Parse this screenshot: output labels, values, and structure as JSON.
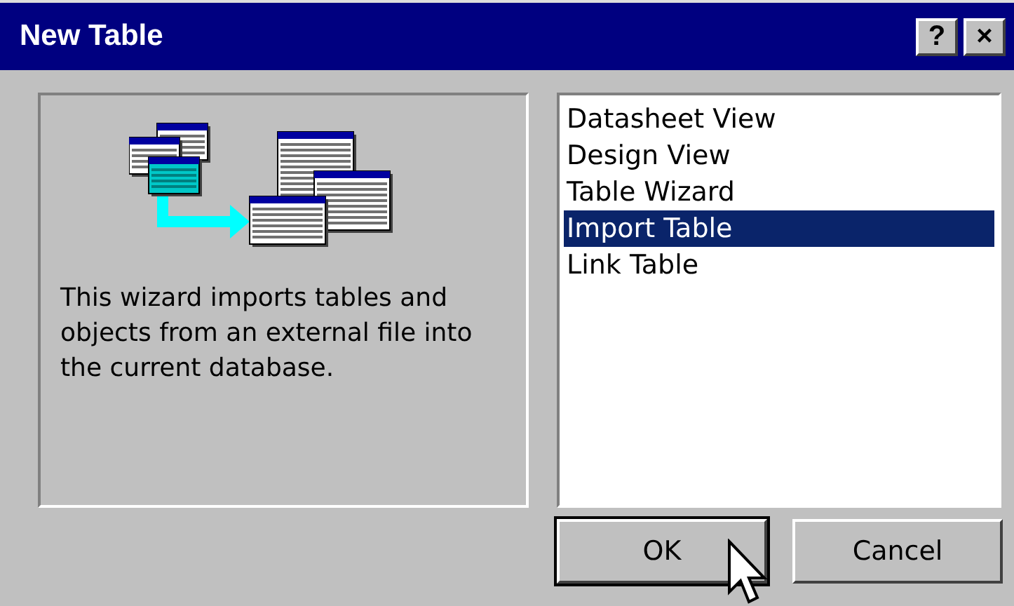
{
  "window": {
    "title": "New Table",
    "help_button": "?",
    "close_button": "×"
  },
  "description": "This wizard imports tables and objects from an external file into the current database.",
  "list": [
    {
      "label": "Datasheet View",
      "selected": false
    },
    {
      "label": "Design View",
      "selected": false
    },
    {
      "label": "Table Wizard",
      "selected": false
    },
    {
      "label": "Import Table",
      "selected": true
    },
    {
      "label": "Link Table",
      "selected": false
    }
  ],
  "buttons": [
    {
      "label": "OK",
      "focused": true
    },
    {
      "label": "Cancel",
      "focused": false
    }
  ]
}
